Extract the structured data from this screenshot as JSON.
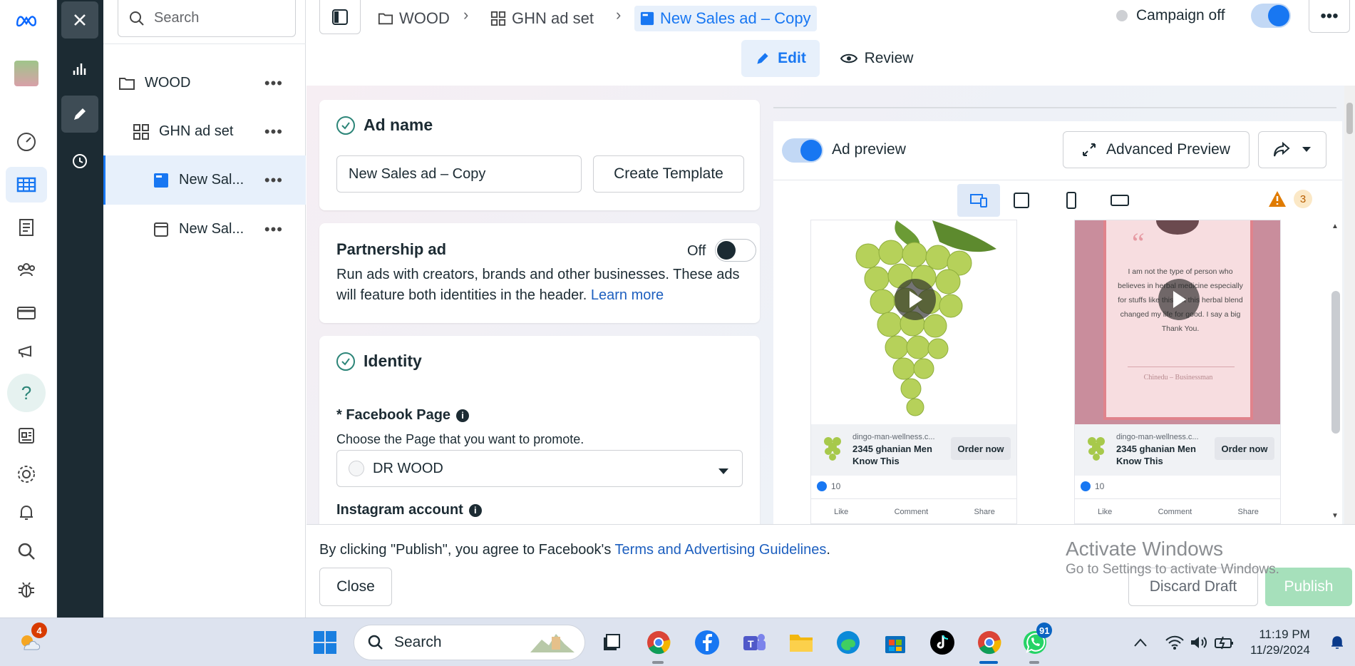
{
  "tree": {
    "search_placeholder": "Search",
    "items": [
      {
        "label": "WOOD"
      },
      {
        "label": "GHN ad set"
      },
      {
        "label": "New Sal..."
      },
      {
        "label": "New Sal..."
      }
    ],
    "more_label": "•••"
  },
  "topbar": {
    "breadcrumb": [
      "WOOD",
      "GHN ad set",
      "New Sales ad – Copy"
    ],
    "campaign_status": "Campaign off",
    "more_label": "•••",
    "tab_edit": "Edit",
    "tab_review": "Review"
  },
  "ad_name_card": {
    "title": "Ad name",
    "value": "New Sales ad – Copy",
    "create_template": "Create Template"
  },
  "partnership_card": {
    "title": "Partnership ad",
    "toggle_label": "Off",
    "description": "Run ads with creators, brands and other businesses. These ads will feature both identities in the header.",
    "learn_more": "Learn more"
  },
  "identity_card": {
    "title": "Identity",
    "facebook_page_label": "* Facebook Page",
    "facebook_page_help": "Choose the Page that you want to promote.",
    "facebook_page_value": "DR WOOD",
    "instagram_label": "Instagram account"
  },
  "preview": {
    "label": "Ad preview",
    "advanced_preview": "Advanced Preview",
    "warning_count": "3",
    "ads": [
      {
        "url": "dingo-man-wellness.c...",
        "headline": "2345 ghanian Men Know This",
        "cta": "Order now",
        "likes": "10",
        "actions": [
          "Like",
          "Comment",
          "Share"
        ]
      },
      {
        "url": "dingo-man-wellness.c...",
        "headline": "2345 ghanian Men Know This",
        "cta": "Order now",
        "likes": "10",
        "actions": [
          "Like",
          "Comment",
          "Share"
        ],
        "quote": "I am not the type of person who believes in herbal medicine especially for stuffs like this but this herbal blend changed my life for good. I say a big Thank You.",
        "quote_author": "Chinedu – Businessman"
      }
    ]
  },
  "footer": {
    "terms_prefix": "By clicking \"Publish\", you agree to Facebook's ",
    "terms_link": "Terms and Advertising Guidelines",
    "terms_suffix": ".",
    "close": "Close",
    "discard": "Discard Draft",
    "publish": "Publish"
  },
  "watermark": {
    "line1": "Activate Windows",
    "line2": "Go to Settings to activate Windows."
  },
  "taskbar": {
    "search_placeholder": "Search",
    "weather_badge": "4",
    "whatsapp_badge": "91",
    "time": "11:19 PM",
    "date": "11/29/2024"
  },
  "colors": {
    "accent": "#1877f2",
    "rail_dark": "#1c2b33",
    "success": "#2c8578",
    "publish_disabled": "#a6e0bb"
  }
}
